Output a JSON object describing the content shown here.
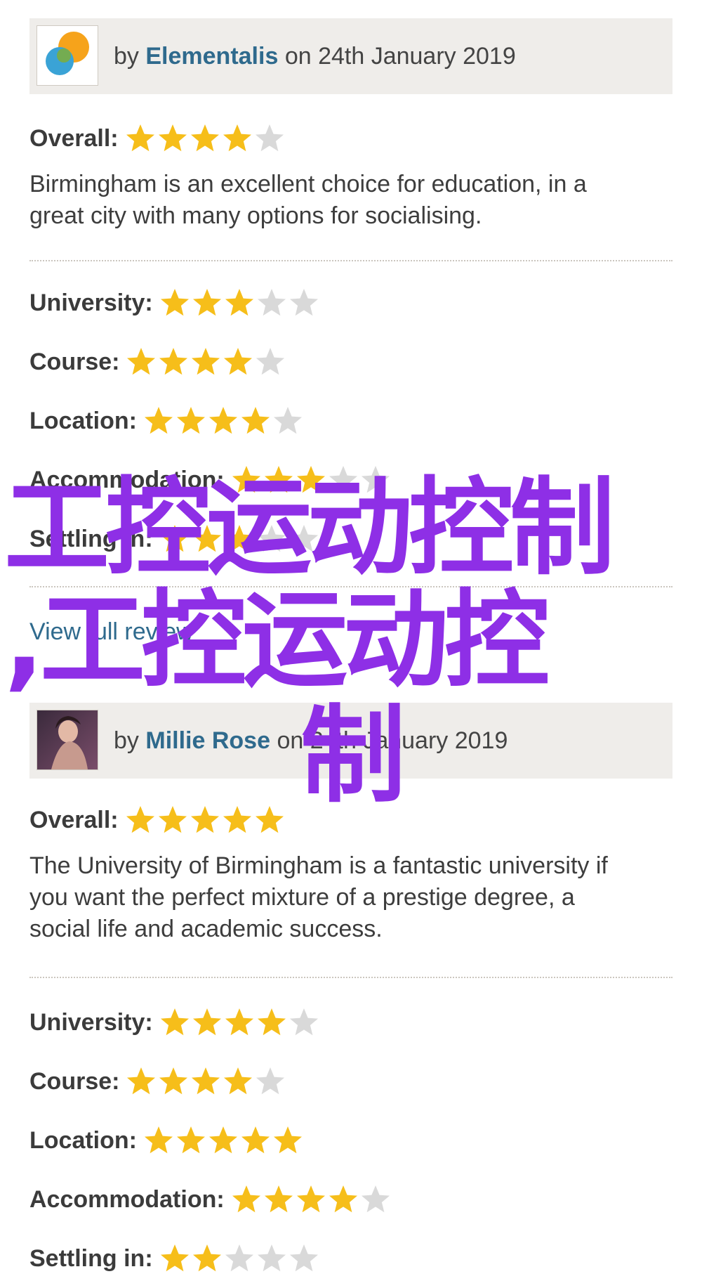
{
  "reviews": [
    {
      "by": "by",
      "author": "Elementalis",
      "date": "on 24th January 2019",
      "avatar_icon": "bubbles-avatar-icon",
      "overall_label": "Overall:",
      "overall_rating": 4,
      "description_lines": [
        "Birmingham is an excellent choice for education, in a",
        "great city with many options for socialising."
      ],
      "ratings": [
        {
          "label": "University:",
          "value": 3
        },
        {
          "label": "Course:",
          "value": 4
        },
        {
          "label": "Location:",
          "value": 4
        },
        {
          "label": "Accommodation:",
          "value": 3
        },
        {
          "label": "Settling in:",
          "value": 3
        }
      ],
      "link": "View full review"
    },
    {
      "by": "by",
      "author": "Millie Rose",
      "date": "on 24th January 2019",
      "avatar_icon": "photo-avatar-icon",
      "overall_label": "Overall:",
      "overall_rating": 5,
      "description_lines": [
        "The University of Birmingham is a fantastic university if",
        "you want the perfect mixture of a prestige degree, a",
        "social life and academic success."
      ],
      "ratings": [
        {
          "label": "University:",
          "value": 4
        },
        {
          "label": "Course:",
          "value": 4
        },
        {
          "label": "Location:",
          "value": 5
        },
        {
          "label": "Accommodation:",
          "value": 4
        },
        {
          "label": "Settling in:",
          "value": 2
        }
      ]
    }
  ],
  "rating_max": 5,
  "overlay": {
    "line1": "工控运动控制",
    "line2": ",工控运动控",
    "line3": "制"
  },
  "colors": {
    "star_filled": "#f6be1a",
    "star_empty": "#d9d9d9",
    "link": "#2f6a8d",
    "overlay": "#8e2fe6"
  }
}
